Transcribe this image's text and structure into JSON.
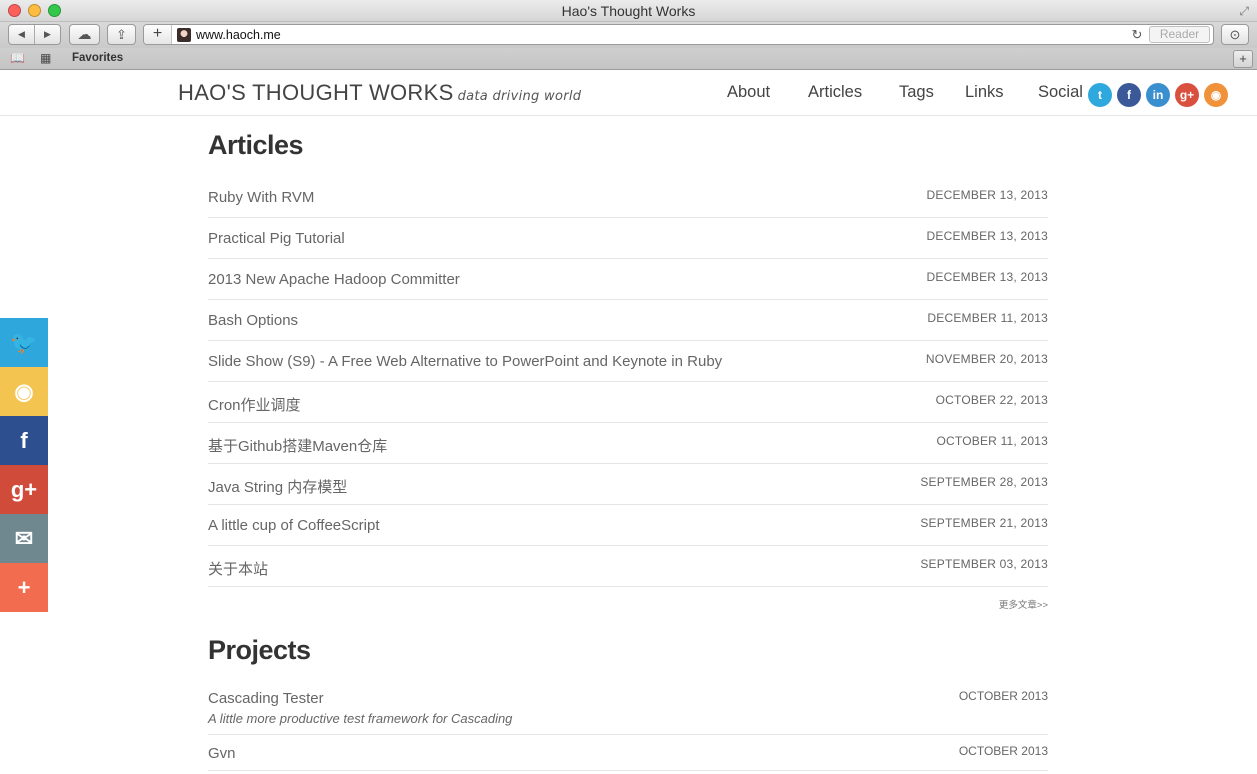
{
  "window": {
    "title": "Hao's Thought Works"
  },
  "toolbar": {
    "url": "www.haoch.me",
    "reader_label": "Reader"
  },
  "bookmarks": {
    "favorites_label": "Favorites"
  },
  "site": {
    "brand": "HAO'S THOUGHT WORKS",
    "tagline": "data driving world",
    "nav": [
      {
        "label": "About"
      },
      {
        "label": "Articles"
      },
      {
        "label": "Tags"
      },
      {
        "label": "Links"
      },
      {
        "label": "Social"
      }
    ],
    "social_icons": [
      {
        "name": "twitter-icon",
        "glyph": "t",
        "color": "#2fa8de"
      },
      {
        "name": "facebook-icon",
        "glyph": "f",
        "color": "#3b5998"
      },
      {
        "name": "linkedin-icon",
        "glyph": "in",
        "color": "#3a8fcf"
      },
      {
        "name": "google-plus-icon",
        "glyph": "g+",
        "color": "#d9503f"
      },
      {
        "name": "rss-icon",
        "glyph": "◉",
        "color": "#f0923a"
      }
    ]
  },
  "articles": {
    "heading": "Articles",
    "items": [
      {
        "title": "Ruby With RVM",
        "date": "DECEMBER 13, 2013"
      },
      {
        "title": "Practical Pig Tutorial",
        "date": "DECEMBER 13, 2013"
      },
      {
        "title": "2013 New Apache Hadoop Committer",
        "date": "DECEMBER 13, 2013"
      },
      {
        "title": "Bash Options",
        "date": "DECEMBER 11, 2013"
      },
      {
        "title": "Slide Show (S9) - A Free Web Alternative to PowerPoint and Keynote in Ruby",
        "date": "NOVEMBER 20, 2013"
      },
      {
        "title": "Cron作业调度",
        "date": "OCTOBER 22, 2013"
      },
      {
        "title": "基于Github搭建Maven仓库",
        "date": "OCTOBER 11, 2013"
      },
      {
        "title": "Java String 内存模型",
        "date": "SEPTEMBER 28, 2013"
      },
      {
        "title": "A little cup of CoffeeScript",
        "date": "SEPTEMBER 21, 2013"
      },
      {
        "title": "关于本站",
        "date": "SEPTEMBER 03, 2013"
      }
    ],
    "more_label": "更多文章>>"
  },
  "projects": {
    "heading": "Projects",
    "items": [
      {
        "title": "Cascading Tester",
        "desc": "A little more productive test framework for Cascading",
        "date": "OCTOBER 2013"
      },
      {
        "title": "Gvn",
        "desc": "",
        "date": "OCTOBER 2013"
      }
    ]
  },
  "sharebar": [
    {
      "name": "twitter-share-icon",
      "glyph": "🐦",
      "color": "#2ea8dc"
    },
    {
      "name": "weibo-share-icon",
      "glyph": "◉",
      "color": "#f3c44f"
    },
    {
      "name": "facebook-share-icon",
      "glyph": "f",
      "color": "#2d4f8f"
    },
    {
      "name": "google-plus-share-icon",
      "glyph": "g+",
      "color": "#d14b3b"
    },
    {
      "name": "email-share-icon",
      "glyph": "✉",
      "color": "#6f878f"
    },
    {
      "name": "more-share-icon",
      "glyph": "+",
      "color": "#f26d4f"
    }
  ]
}
